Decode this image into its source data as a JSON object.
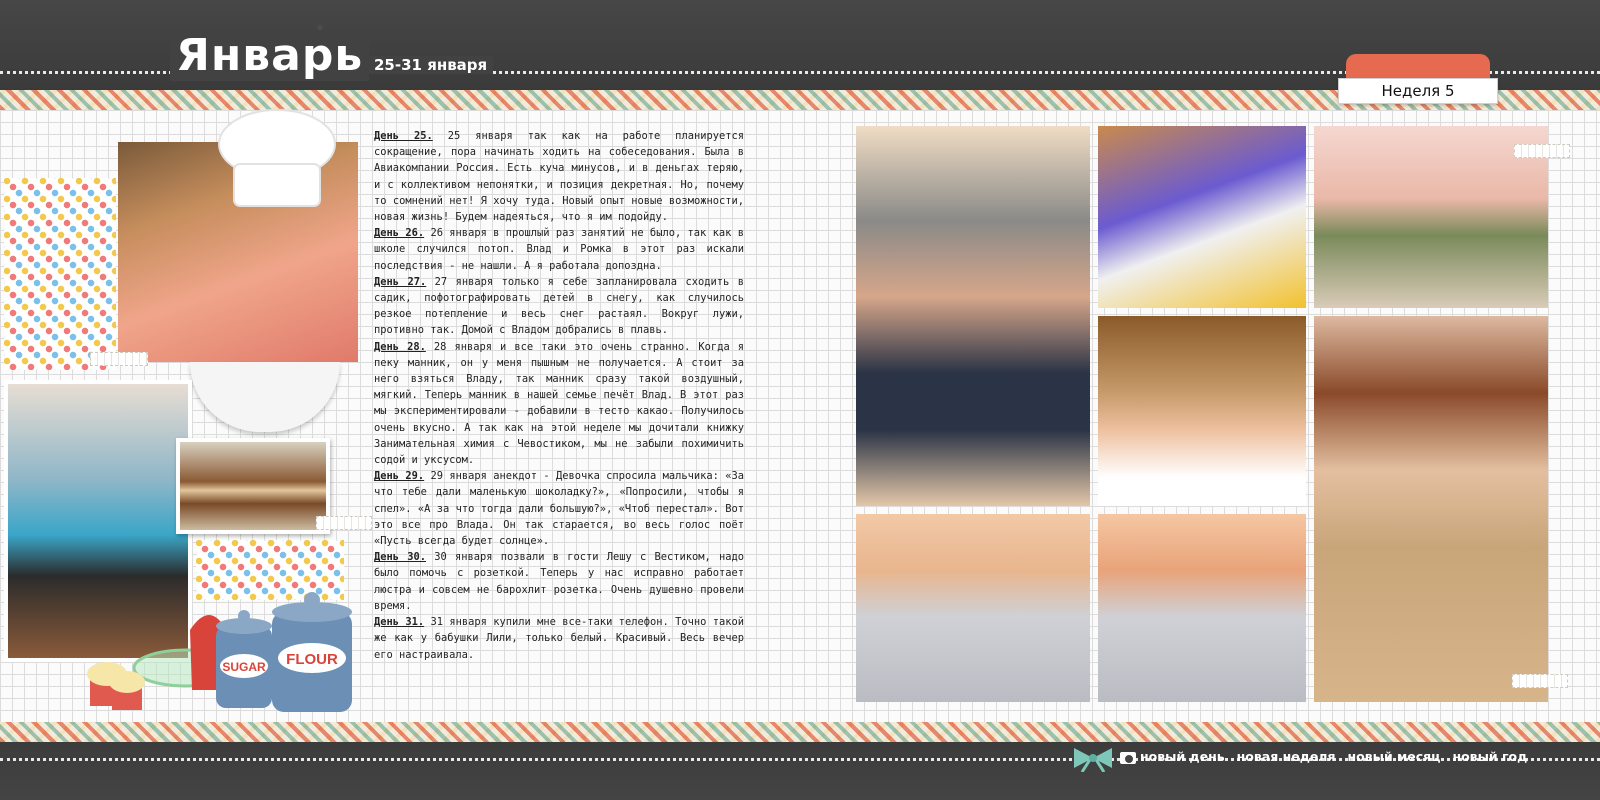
{
  "header": {
    "month": "Январь",
    "date_range": "25-31 января",
    "week_label": "Неделя 5"
  },
  "journal": [
    {
      "day": "День 25.",
      "text": " 25 января так как на работе планируется сокращение, пора начинать ходить на собеседования. Была в Авиакомпании Россия. Есть куча минусов, и в деньгах теряю, и с коллективом непонятки, и позиция декретная. Но, почему то сомнений нет! Я хочу туда. Новый опыт новые возможности, новая жизнь! Будем надеяться, что я им подойду."
    },
    {
      "day": "День 26.",
      "text": " 26 января в прошлый раз занятий не было, так как в школе случился потоп. Влад и Ромка в этот раз искали последствия - не нашли. А я работала допоздна."
    },
    {
      "day": "День 27.",
      "text": " 27 января только я себе запланировала сходить в садик, пофотографировать детей в снегу, как случилось резкое потепление и весь снег растаял. Вокруг лужи, противно так. Домой с Владом добрались в плавь."
    },
    {
      "day": "День 28.",
      "text": " 28 января и все таки это очень странно. Когда я пеку манник, он у меня пышным не получается. А стоит за него взяться Владу, так манник сразу такой воздушный, мягкий. Теперь манник в нашей семье печёт Влад. В этот раз мы экспериментировали - добавили в тесто какао. Получилось очень вкусно. А так как на этой неделе мы дочитали книжку Занимательная химия с Чевостиком, мы не забыли похимичить содой и уксусом."
    },
    {
      "day": "День 29.",
      "text": " 29 января анекдот - Девочка спросила мальчика: «За что тебе дали маленькую шоколадку?», «Попросили, чтобы я спел». «А за что тогда дали большую?», «Чтоб перестал». Вот это все про Влада. Он так старается, во весь голос поёт «Пусть всегда будет солнце»."
    },
    {
      "day": "День 30.",
      "text": " 30 января позвали в гости Лешу с Вестиком, надо было помочь с розеткой. Теперь у нас исправно работает люстра и совсем не барохлит розетка. Очень душевно провели время."
    },
    {
      "day": "День 31.",
      "text": " 31 января купили мне все-таки телефон. Точно такой же как у бабушки Лили, только белый. Красивый. Весь вечер его настраивала."
    }
  ],
  "jars": {
    "sugar_label": "SUGAR",
    "flour_label": "FLOUR"
  },
  "footer_nav": {
    "new_day": "новый день",
    "new_week": "новая неделя",
    "new_month": "новый месяц",
    "new_year": "новый год"
  },
  "icons": {
    "camera": "camera-icon",
    "bow": "bow-icon",
    "chef_hat": "chef-hat-icon"
  },
  "colors": {
    "board": "#3f3f3f",
    "tab_accent": "#e56a4f",
    "text": "#222222"
  }
}
